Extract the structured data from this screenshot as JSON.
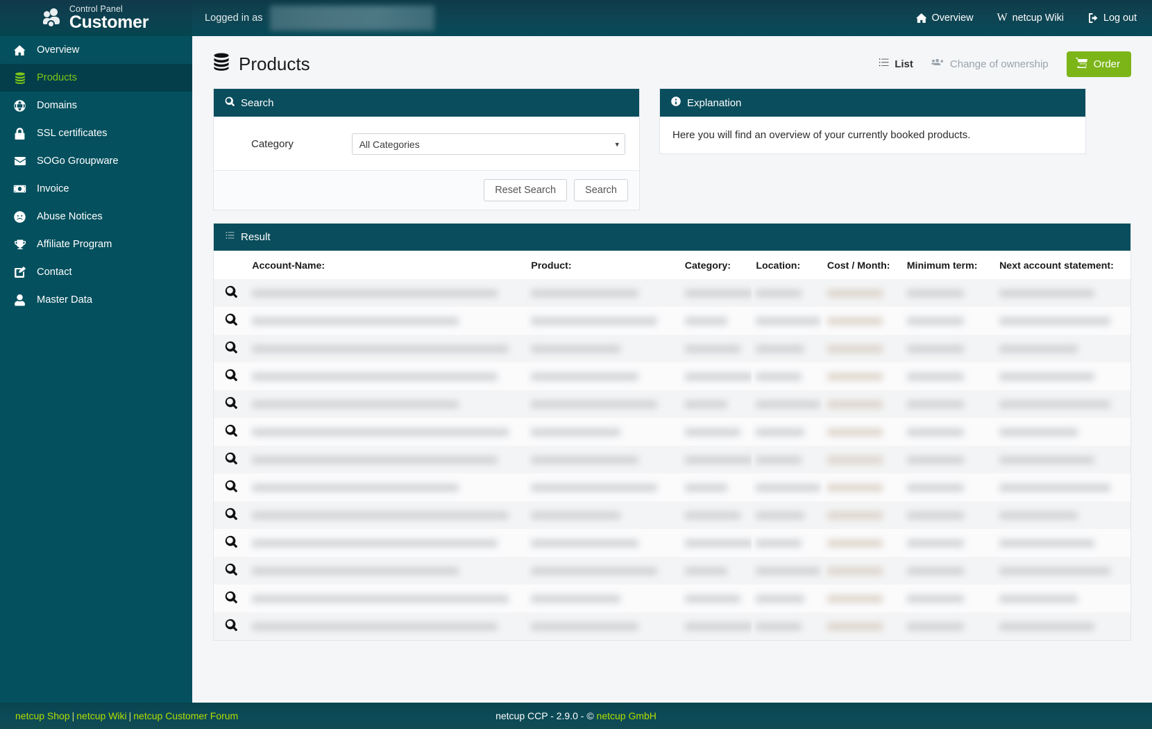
{
  "topbar": {
    "brand_top": "Control Panel",
    "brand_bottom": "Customer",
    "brand_icon": "users-gear-icon",
    "logged_in_label": "Logged in as",
    "logged_in_value": "",
    "nav": [
      {
        "label": "Overview",
        "icon": "home-icon"
      },
      {
        "label": "netcup Wiki",
        "icon": "wikipedia-w-icon"
      },
      {
        "label": "Log out",
        "icon": "logout-icon"
      }
    ]
  },
  "sidebar": {
    "items": [
      {
        "label": "Overview",
        "icon": "home-icon",
        "active": false
      },
      {
        "label": "Products",
        "icon": "database-icon",
        "active": true
      },
      {
        "label": "Domains",
        "icon": "globe-icon",
        "active": false
      },
      {
        "label": "SSL certificates",
        "icon": "lock-icon",
        "active": false
      },
      {
        "label": "SOGo Groupware",
        "icon": "envelope-icon",
        "active": false
      },
      {
        "label": "Invoice",
        "icon": "money-bill-icon",
        "active": false
      },
      {
        "label": "Abuse Notices",
        "icon": "frown-face-icon",
        "active": false
      },
      {
        "label": "Affiliate Program",
        "icon": "trophy-icon",
        "active": false
      },
      {
        "label": "Contact",
        "icon": "pencil-square-icon",
        "active": false
      },
      {
        "label": "Master Data",
        "icon": "user-icon",
        "active": false
      }
    ],
    "active_color": "#7ec618"
  },
  "page": {
    "title": "Products",
    "title_icon": "database-icon",
    "actions": {
      "list_label": "List",
      "list_icon": "list-icon",
      "change_ownership_label": "Change of ownership",
      "change_ownership_icon": "users-gear-icon",
      "order_label": "Order",
      "order_icon": "shopping-cart-icon",
      "order_color": "#7cb518"
    }
  },
  "search_panel": {
    "title": "Search",
    "title_icon": "magnifier-icon",
    "category_label": "Category",
    "category_value": "All Categories",
    "category_options": [
      "All Categories"
    ],
    "reset_label": "Reset Search",
    "search_label": "Search"
  },
  "explanation_panel": {
    "title": "Explanation",
    "title_icon": "info-circle-icon",
    "text": "Here you will find an overview of your currently booked products."
  },
  "result_panel": {
    "title": "Result",
    "title_icon": "list-icon",
    "columns": [
      "",
      "Account-Name:",
      "Product:",
      "Category:",
      "Location:",
      "Cost / Month:",
      "Minimum term:",
      "Next account statement:"
    ],
    "row_icon": "magnifier-icon",
    "row_count": 13,
    "rows_redacted": true
  },
  "footer": {
    "links": [
      {
        "label": "netcup Shop"
      },
      {
        "label": "netcup Wiki"
      },
      {
        "label": "netcup Customer Forum"
      }
    ],
    "separator": "|",
    "center_prefix": "netcup CCP - 2.9.0 - © ",
    "center_link": "netcup GmbH"
  }
}
